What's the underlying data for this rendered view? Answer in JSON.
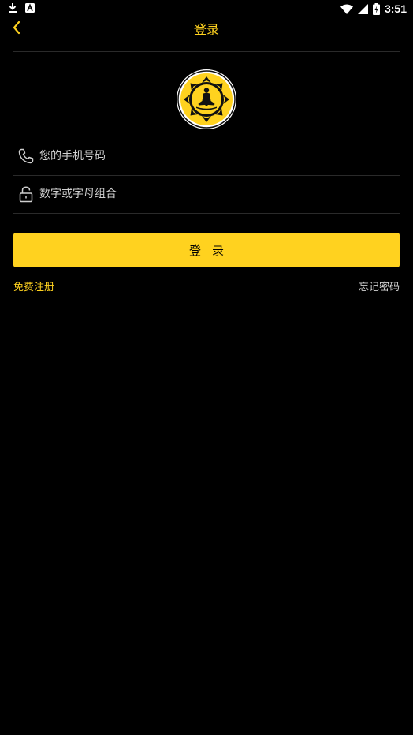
{
  "status_bar": {
    "time": "3:51",
    "icons": [
      "download-icon",
      "notification-a-icon",
      "wifi-icon",
      "signal-icon",
      "battery-charging-icon"
    ]
  },
  "header": {
    "title": "登录",
    "back_icon": "chevron-left-icon"
  },
  "logo": {
    "icon": "meditation-lotus-logo"
  },
  "form": {
    "phone": {
      "placeholder": "您的手机号码",
      "value": "",
      "icon": "phone-icon"
    },
    "password": {
      "placeholder": "数字或字母组合",
      "value": "",
      "icon": "lock-icon"
    },
    "login_label": "登录"
  },
  "links": {
    "register": "免费注册",
    "forgot_password": "忘记密码"
  },
  "colors": {
    "background": "#000000",
    "accent": "#ffd21f",
    "divider": "#2a2a2a",
    "secondary_text": "#cfcfcf"
  }
}
